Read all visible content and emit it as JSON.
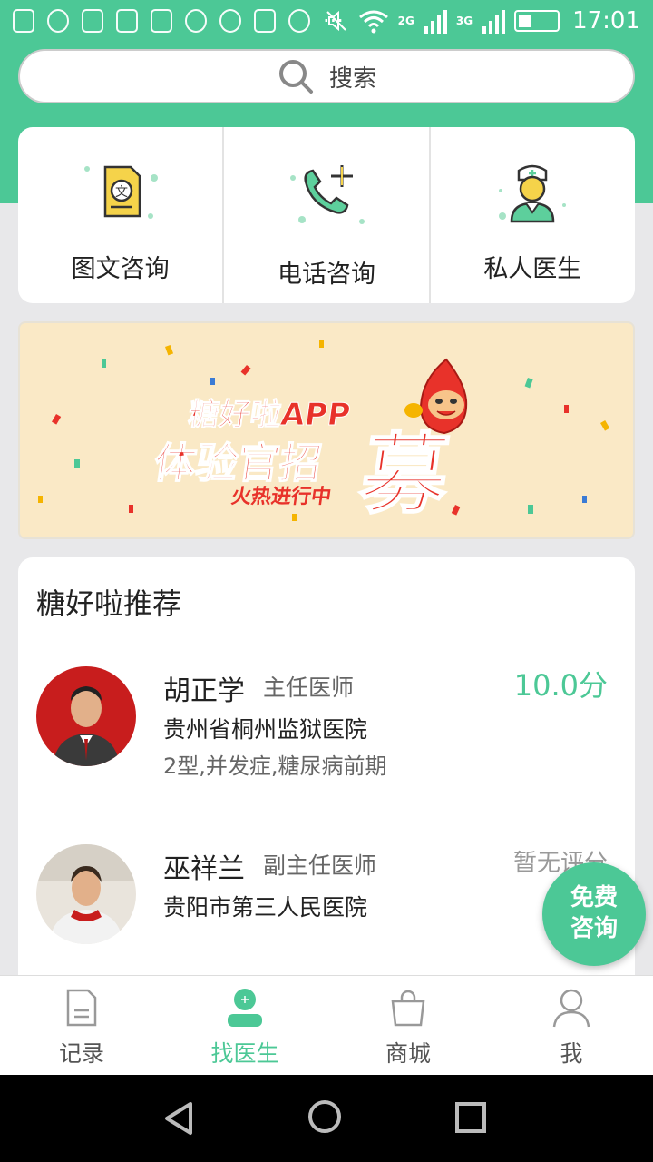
{
  "status_bar": {
    "time": "17:01",
    "network_2g": "2G",
    "network_3g": "3G"
  },
  "search": {
    "placeholder": "搜索"
  },
  "consult_options": [
    {
      "label": "图文咨询",
      "icon": "document-text-icon"
    },
    {
      "label": "电话咨询",
      "icon": "phone-plus-icon"
    },
    {
      "label": "私人医生",
      "icon": "nurse-icon"
    }
  ],
  "banner": {
    "line1": "糖好啦APP",
    "line2": "体验官招",
    "big_char": "募",
    "line3": "火热进行中"
  },
  "recommend": {
    "title": "糖好啦推荐",
    "doctors": [
      {
        "name": "胡正学",
        "title": "主任医师",
        "score": "10.0分",
        "hospital": "贵州省桐州监狱医院",
        "tags": "2型,并发症,糖尿病前期"
      },
      {
        "name": "巫祥兰",
        "title": "副主任医师",
        "score": "暂无评分",
        "hospital": "贵阳市第三人民医院",
        "tags": ""
      }
    ]
  },
  "fab": {
    "line1": "免费",
    "line2": "咨询"
  },
  "tabbar": {
    "items": [
      {
        "label": "记录",
        "icon": "record-icon"
      },
      {
        "label": "找医生",
        "icon": "doctor-icon"
      },
      {
        "label": "商城",
        "icon": "shopping-bag-icon"
      },
      {
        "label": "我",
        "icon": "profile-icon"
      }
    ],
    "active": "找医生"
  },
  "colors": {
    "accent": "#4cc896",
    "banner_bg": "#fae9c6",
    "banner_red": "#e8322a"
  }
}
